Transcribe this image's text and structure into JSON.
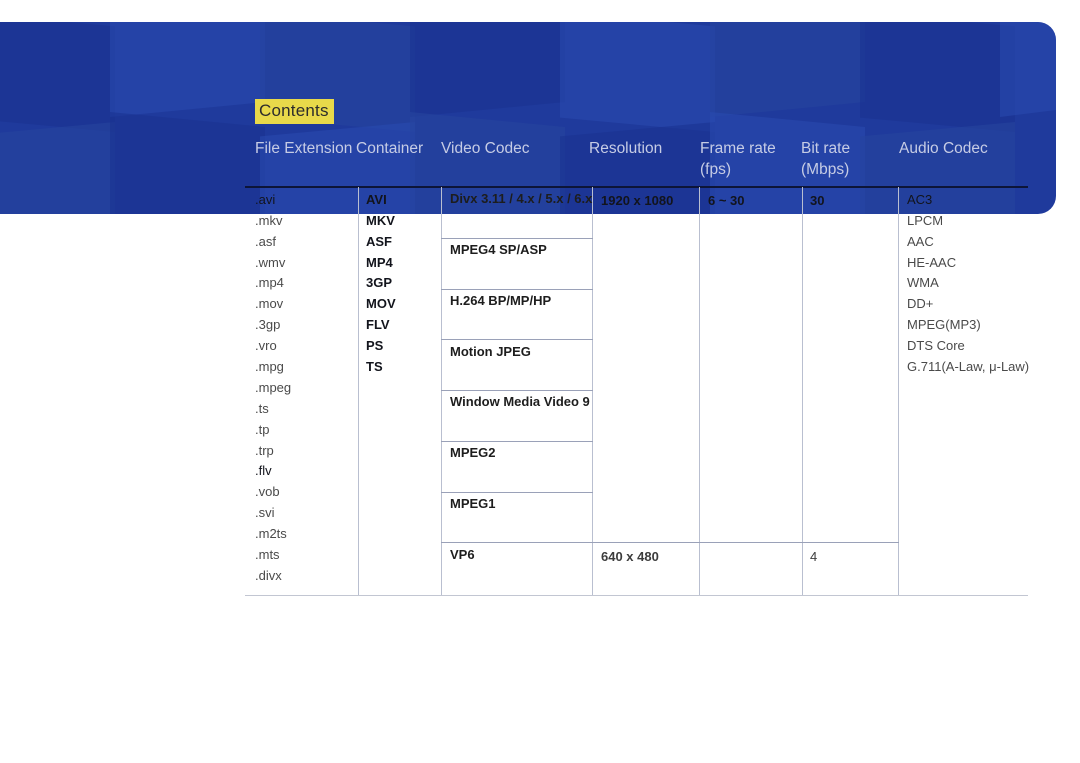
{
  "banner": {
    "accent_color": "#1f3a9c",
    "highlight_color": "#e8d94a"
  },
  "contents_tag": "Contents",
  "table": {
    "headers": [
      "File Extension",
      "Container",
      "Video Codec",
      "Resolution",
      "Frame rate",
      "Bit rate",
      "Audio Codec"
    ],
    "header_sublines": [
      "",
      "",
      "",
      "",
      "(fps)",
      "(Mbps)",
      ""
    ],
    "file_extensions": [
      ".avi",
      ".mkv",
      ".asf",
      ".wmv",
      ".mp4",
      ".mov",
      ".3gp",
      ".vro",
      ".mpg",
      ".mpeg",
      ".ts",
      ".tp",
      ".trp",
      ".flv",
      ".vob",
      ".svi",
      ".m2ts",
      ".mts",
      ".divx"
    ],
    "containers": [
      "AVI",
      "MKV",
      "ASF",
      "MP4",
      "3GP",
      "MOV",
      "FLV",
      "PS",
      "TS"
    ],
    "video_codecs": [
      {
        "name": "Divx 3.11 / 4.x / 5.x / 6.x",
        "resolution": "1920 x 1080",
        "frame_rate": "6 ~ 30",
        "bit_rate": "30"
      },
      {
        "name": "MPEG4 SP/ASP",
        "resolution": "",
        "frame_rate": "",
        "bit_rate": ""
      },
      {
        "name": "H.264 BP/MP/HP",
        "resolution": "",
        "frame_rate": "",
        "bit_rate": ""
      },
      {
        "name": "Motion JPEG",
        "resolution": "",
        "frame_rate": "",
        "bit_rate": ""
      },
      {
        "name": "Window Media Video 9",
        "resolution": "",
        "frame_rate": "",
        "bit_rate": ""
      },
      {
        "name": "MPEG2",
        "resolution": "",
        "frame_rate": "",
        "bit_rate": ""
      },
      {
        "name": "MPEG1",
        "resolution": "",
        "frame_rate": "",
        "bit_rate": ""
      },
      {
        "name": "VP6",
        "resolution": "640 x 480",
        "frame_rate": "",
        "bit_rate": "4"
      }
    ],
    "audio_codecs": [
      "AC3",
      "LPCM",
      "AAC",
      "HE-AAC",
      "WMA",
      "DD+",
      "MPEG(MP3)",
      "DTS Core",
      "G.711(A-Law, μ-Law)"
    ]
  }
}
